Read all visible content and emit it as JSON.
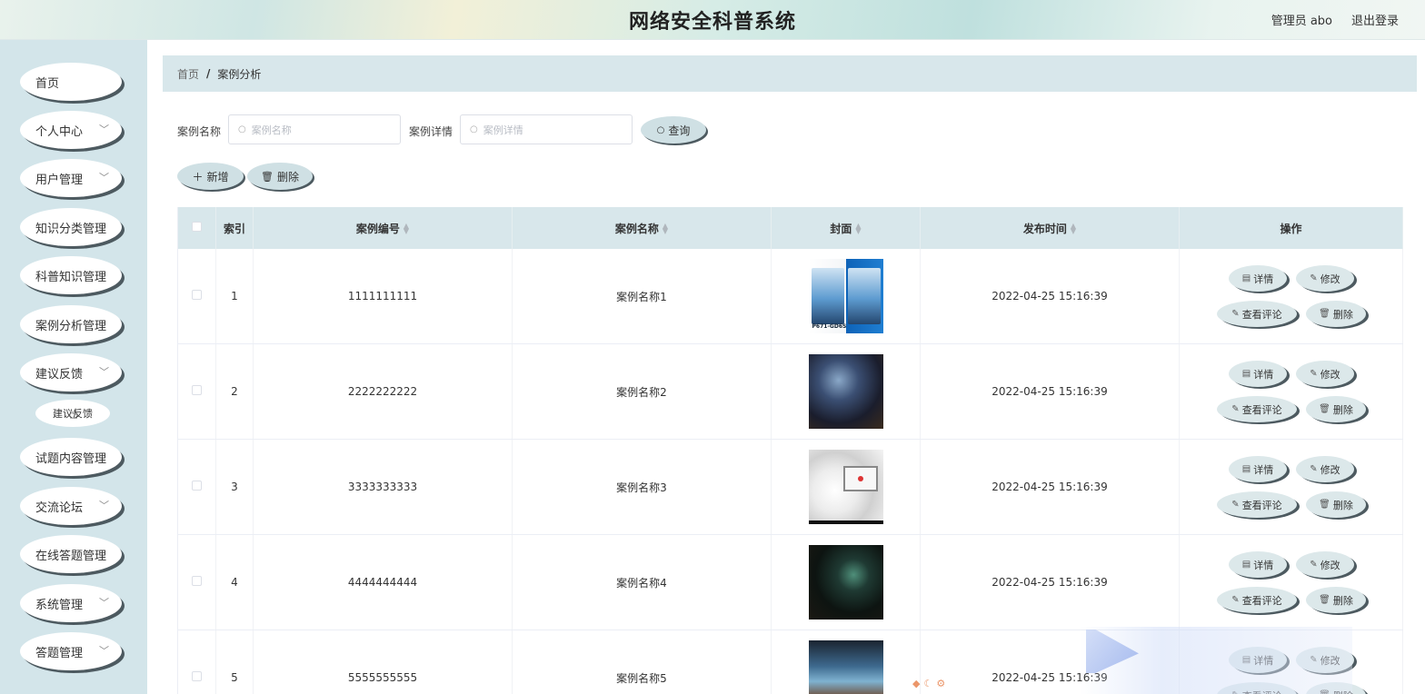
{
  "header": {
    "title": "网络安全科普系统",
    "user": "管理员 abo",
    "logout": "退出登录"
  },
  "sidebar": {
    "items": [
      {
        "label": "首页",
        "has_children": false
      },
      {
        "label": "个人中心",
        "has_children": true
      },
      {
        "label": "用户管理",
        "has_children": true
      },
      {
        "label": "知识分类管理",
        "has_children": false
      },
      {
        "label": "科普知识管理",
        "has_children": false
      },
      {
        "label": "案例分析管理",
        "has_children": false
      },
      {
        "label": "建议反馈",
        "has_children": true
      },
      {
        "label": "试题内容管理",
        "has_children": false
      },
      {
        "label": "交流论坛",
        "has_children": true
      },
      {
        "label": "在线答题管理",
        "has_children": false
      },
      {
        "label": "系统管理",
        "has_children": true
      },
      {
        "label": "答题管理",
        "has_children": true
      }
    ],
    "subitem": "建议反馈"
  },
  "breadcrumb": {
    "home": "首页",
    "sep": "/",
    "current": "案例分析"
  },
  "search": {
    "name_label": "案例名称",
    "name_placeholder": "案例名称",
    "detail_label": "案例详情",
    "detail_placeholder": "案例详情",
    "query_button": "查询"
  },
  "toolbar": {
    "add": "新增",
    "delete": "删除"
  },
  "table": {
    "headers": {
      "index": "索引",
      "code": "案例编号",
      "name": "案例名称",
      "cover": "封面",
      "time": "发布时间",
      "ops": "操作"
    },
    "rows": [
      {
        "index": "1",
        "code": "1111111111",
        "name": "案例名称1",
        "time": "2022-04-25 15:16:39"
      },
      {
        "index": "2",
        "code": "2222222222",
        "name": "案例名称2",
        "time": "2022-04-25 15:16:39"
      },
      {
        "index": "3",
        "code": "3333333333",
        "name": "案例名称3",
        "time": "2022-04-25 15:16:39"
      },
      {
        "index": "4",
        "code": "4444444444",
        "name": "案例名称4",
        "time": "2022-04-25 15:16:39"
      },
      {
        "index": "5",
        "code": "5555555555",
        "name": "案例名称5",
        "time": "2022-04-25 15:16:39"
      }
    ],
    "ops": {
      "detail": "详情",
      "edit": "修改",
      "comments": "查看评论",
      "delete": "删除"
    }
  },
  "cover_image": {
    "text": "P671-GD6S"
  },
  "colors": {
    "sidebar_bg": "#d3e5ea",
    "table_header_bg": "#d8e7eb",
    "button_bg": "#cfe0e4",
    "button_shadow": "#4d5a60"
  }
}
